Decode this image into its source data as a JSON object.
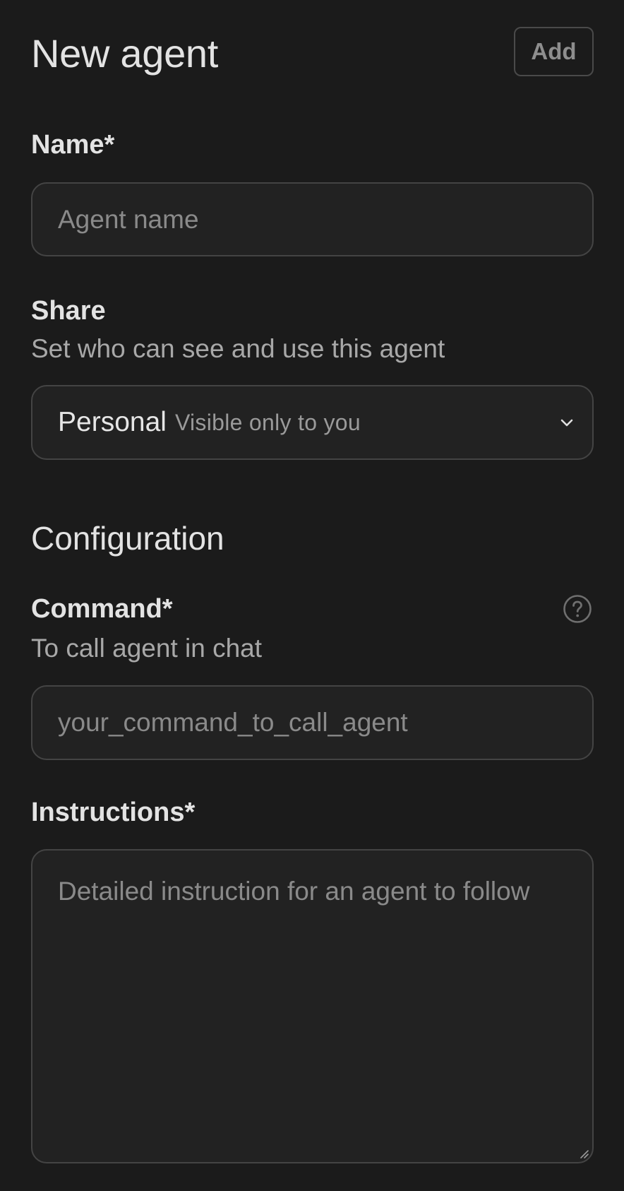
{
  "header": {
    "title": "New agent",
    "add_label": "Add"
  },
  "name": {
    "label": "Name*",
    "placeholder": "Agent name",
    "value": ""
  },
  "share": {
    "label": "Share",
    "description": "Set who can see and use this agent",
    "selected": "Personal",
    "selected_hint": "Visible only to you",
    "icon": "chevron-down-icon"
  },
  "configuration": {
    "title": "Configuration",
    "command": {
      "label": "Command*",
      "description": "To call agent in chat",
      "placeholder": "your_command_to_call_agent",
      "value": "",
      "help_icon": "question-circle-icon"
    },
    "instructions": {
      "label": "Instructions*",
      "placeholder": "Detailed instruction for an agent to follow",
      "value": ""
    }
  },
  "colors": {
    "background": "#1b1b1b",
    "field_background": "#222222",
    "border": "#444444",
    "text": "#e3e3e3",
    "muted": "#8a8a8a"
  }
}
